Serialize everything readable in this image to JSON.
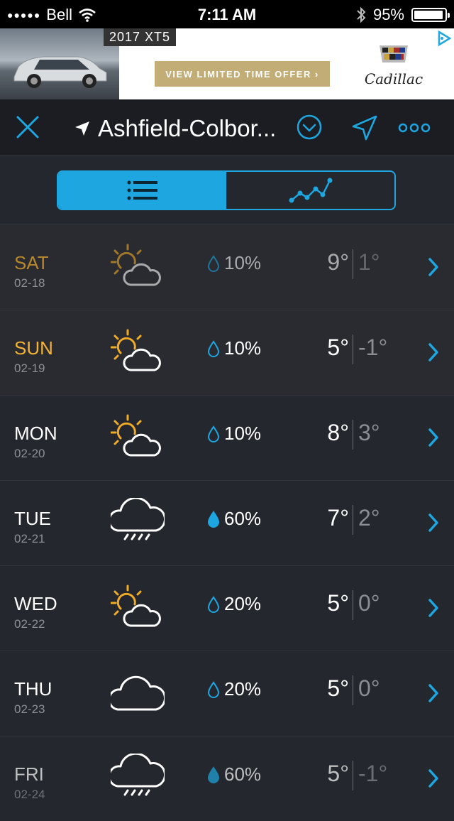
{
  "status": {
    "carrier": "Bell",
    "time": "7:11 AM",
    "battery": "95%",
    "battery_level": 0.95
  },
  "ad": {
    "tag": "2017 XT5",
    "cta": "VIEW LIMITED TIME OFFER ›",
    "brand": "Cadillac"
  },
  "toolbar": {
    "location": "Ashfield-Colbor..."
  },
  "colors": {
    "accent": "#1da6df",
    "sun": "#f1ac27",
    "past_day": "#b8872c",
    "today_day": "#f5b331",
    "background": "#24272d"
  },
  "forecast": [
    {
      "day": "SAT",
      "date": "02-18",
      "icon": "partly-sunny-icon",
      "precip": "10%",
      "hi": "9°",
      "lo": "1°"
    },
    {
      "day": "SUN",
      "date": "02-19",
      "icon": "partly-sunny-icon",
      "precip": "10%",
      "hi": "5°",
      "lo": "-1°"
    },
    {
      "day": "MON",
      "date": "02-20",
      "icon": "partly-sunny-icon",
      "precip": "10%",
      "hi": "8°",
      "lo": "3°"
    },
    {
      "day": "TUE",
      "date": "02-21",
      "icon": "rain-cloud-icon",
      "precip": "60%",
      "hi": "7°",
      "lo": "2°"
    },
    {
      "day": "WED",
      "date": "02-22",
      "icon": "partly-sunny-icon",
      "precip": "20%",
      "hi": "5°",
      "lo": "0°"
    },
    {
      "day": "THU",
      "date": "02-23",
      "icon": "cloud-icon",
      "precip": "20%",
      "hi": "5°",
      "lo": "0°"
    },
    {
      "day": "FRI",
      "date": "02-24",
      "icon": "rain-cloud-icon",
      "precip": "60%",
      "hi": "5°",
      "lo": "-1°"
    }
  ]
}
